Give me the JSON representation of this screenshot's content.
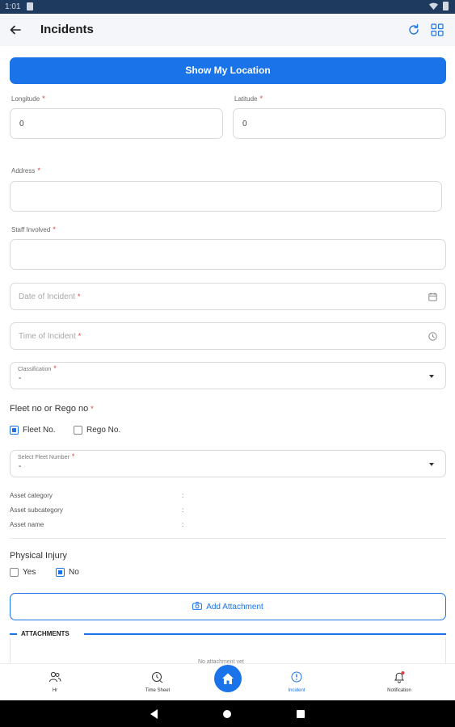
{
  "status_bar": {
    "time": "1:01"
  },
  "appbar": {
    "title": "Incidents"
  },
  "location_button": "Show My Location",
  "longitude": {
    "label": "Longitude",
    "value": "0"
  },
  "latitude": {
    "label": "Latitude",
    "value": "0"
  },
  "address": {
    "label": "Address",
    "value": ""
  },
  "staff": {
    "label": "Staff Involved",
    "value": ""
  },
  "date": {
    "placeholder": "Date of Incident"
  },
  "time": {
    "placeholder": "Time of Incident"
  },
  "classification": {
    "label": "Classification",
    "value": "-"
  },
  "fleet": {
    "title": "Fleet no or Rego no",
    "option_fleet": "Fleet No.",
    "option_rego": "Rego No.",
    "fleet_checked": true,
    "rego_checked": false
  },
  "fleet_select": {
    "label": "Select Fleet Number",
    "value": "-"
  },
  "asset": {
    "category": "Asset category",
    "subcategory": "Asset subcategory",
    "name": "Asset name",
    "sep": ":"
  },
  "injury": {
    "title": "Physical Injury",
    "yes": "Yes",
    "no": "No",
    "yes_checked": false,
    "no_checked": true
  },
  "attach_button": "Add Attachment",
  "attachments": {
    "heading": "ATTACHMENTS",
    "empty": "No attachment yet"
  },
  "bottom_nav": {
    "hr": "Hr",
    "timesheet": "Time Sheet",
    "incident": "Incident",
    "notification": "Notification"
  },
  "colors": {
    "accent": "#1a73e8",
    "required": "#e53935"
  }
}
